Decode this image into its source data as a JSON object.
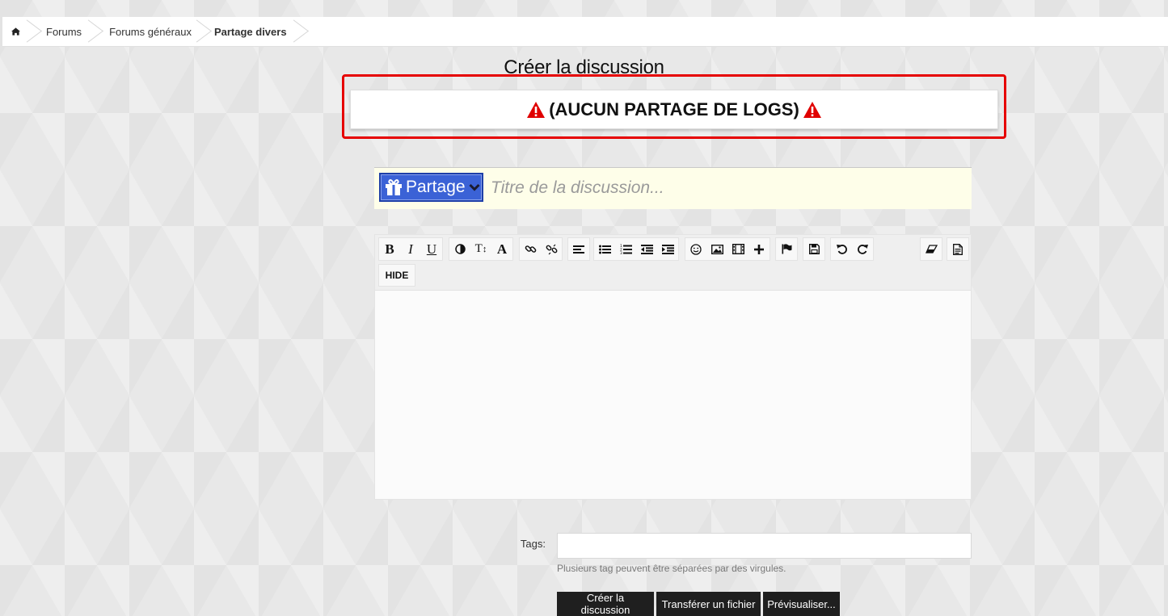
{
  "breadcrumb": {
    "home_icon": "home-icon",
    "items": [
      "Forums",
      "Forums généraux",
      "Partage divers"
    ]
  },
  "page_title": "Créer la discussion",
  "warning": {
    "text": "(AUCUN PARTAGE DE LOGS)",
    "icon": "warning-triangle-icon",
    "frame_color": "#e60000",
    "icon_color": "#e00000"
  },
  "title_row": {
    "prefix_label": "Partage",
    "prefix_icon": "gift-icon",
    "prefix_color": "#3b62d6",
    "title_placeholder": "Titre de la discussion..."
  },
  "editor": {
    "hide_label": "HIDE",
    "toolbar_icons": [
      "bold-icon",
      "italic-icon",
      "underline-icon",
      "color-icon",
      "font-size-icon",
      "font-family-icon",
      "link-icon",
      "unlink-icon",
      "align-icon",
      "bullet-list-icon",
      "numbered-list-icon",
      "outdent-icon",
      "indent-icon",
      "smiley-icon",
      "image-icon",
      "media-icon",
      "insert-more-icon",
      "flag-icon",
      "save-draft-icon",
      "undo-icon",
      "redo-icon",
      "remove-format-icon",
      "source-icon"
    ]
  },
  "tags": {
    "label": "Tags:",
    "value": "",
    "hint": "Plusieurs tag peuvent être séparées par des virgules."
  },
  "actions": {
    "create": "Créer la discussion",
    "upload": "Transférer un fichier",
    "preview": "Prévisualiser..."
  }
}
